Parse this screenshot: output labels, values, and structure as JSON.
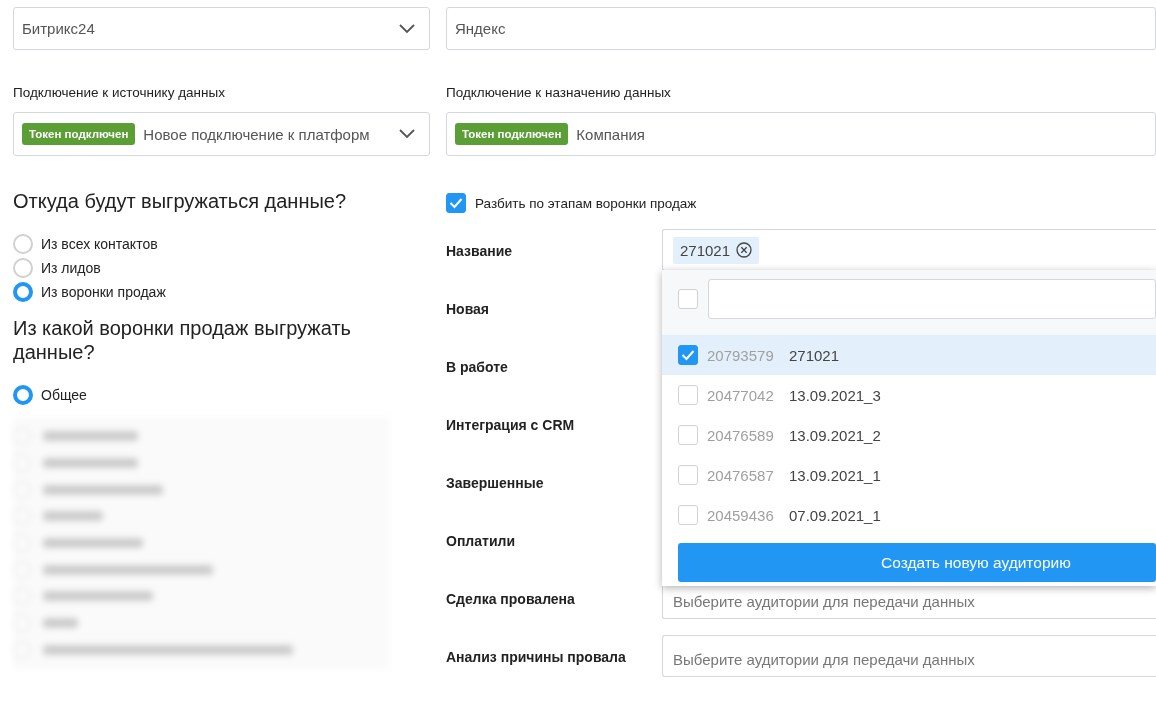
{
  "source_select": {
    "value": "Битрикс24"
  },
  "destination_select": {
    "value": "Яндекс"
  },
  "source_connection": {
    "label": "Подключение к источнику данных",
    "badge": "Токен подключен",
    "value": "Новое подключение к платформ"
  },
  "destination_connection": {
    "label": "Подключение к назначению данных",
    "badge": "Токен подключен",
    "value": "Компания"
  },
  "source_question": {
    "title": "Откуда будут выгружаться данные?",
    "options": [
      {
        "label": "Из всех контактов",
        "selected": false
      },
      {
        "label": "Из лидов",
        "selected": false
      },
      {
        "label": "Из воронки продаж",
        "selected": true
      }
    ]
  },
  "funnel_question": {
    "title": "Из какой воронки продаж выгружать данные?",
    "options": [
      {
        "label": "Общее",
        "selected": true
      }
    ]
  },
  "split_by_stages": {
    "label": "Разбить по этапам воронки продаж",
    "checked": true
  },
  "stages": [
    {
      "label": "Название",
      "field": {
        "tags": [
          "271021"
        ]
      }
    },
    {
      "label": "Новая"
    },
    {
      "label": "В работе"
    },
    {
      "label": "Интеграция с CRM"
    },
    {
      "label": "Завершенные"
    },
    {
      "label": "Оплатили"
    },
    {
      "label": "Сделка провалена",
      "field": {
        "placeholder": "Выберите аудитории для передачи данных"
      }
    },
    {
      "label": "Анализ причины провала",
      "field": {
        "placeholder": "Выберите аудитории для передачи данных"
      }
    }
  ],
  "audience_dropdown": {
    "select_all_checked": false,
    "items": [
      {
        "id": "20793579",
        "name": "271021",
        "checked": true
      },
      {
        "id": "20477042",
        "name": "13.09.2021_3",
        "checked": false
      },
      {
        "id": "20476589",
        "name": "13.09.2021_2",
        "checked": false
      },
      {
        "id": "20476587",
        "name": "13.09.2021_1",
        "checked": false
      },
      {
        "id": "20459436",
        "name": "07.09.2021_1",
        "checked": false
      }
    ],
    "button": "Создать новую аудиторию"
  }
}
